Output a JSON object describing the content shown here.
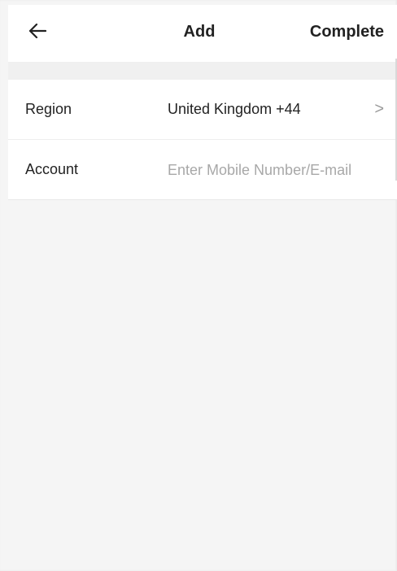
{
  "header": {
    "back_icon": "arrow-left-icon",
    "title": "Add",
    "complete_label": "Complete"
  },
  "form": {
    "region": {
      "label": "Region",
      "value": "United Kingdom +44",
      "chevron": ">"
    },
    "account": {
      "label": "Account",
      "value": "",
      "placeholder": "Enter Mobile Number/E-mail"
    }
  },
  "colors": {
    "background": "#f5f5f5",
    "surface": "#ffffff",
    "text": "#222222",
    "placeholder": "#a8a8a8",
    "chevron": "#9a9a9a"
  }
}
